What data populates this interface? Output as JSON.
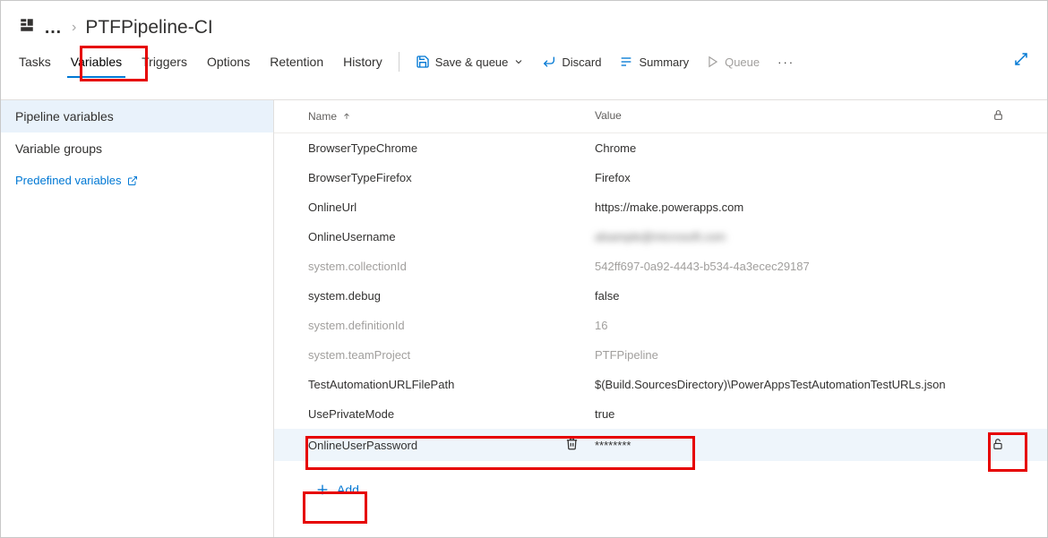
{
  "breadcrumb": {
    "ellipsis": "…",
    "title": "PTFPipeline-CI"
  },
  "tabs": {
    "tasks": "Tasks",
    "variables": "Variables",
    "triggers": "Triggers",
    "options": "Options",
    "retention": "Retention",
    "history": "History"
  },
  "toolbar": {
    "save_queue": "Save & queue",
    "discard": "Discard",
    "summary": "Summary",
    "queue": "Queue"
  },
  "sidebar": {
    "pipeline_vars": "Pipeline variables",
    "variable_groups": "Variable groups",
    "predefined": "Predefined variables"
  },
  "columns": {
    "name": "Name",
    "value": "Value"
  },
  "rows": [
    {
      "name": "BrowserTypeChrome",
      "value": "Chrome",
      "system": false,
      "blurred": false,
      "selected": false
    },
    {
      "name": "BrowserTypeFirefox",
      "value": "Firefox",
      "system": false,
      "blurred": false,
      "selected": false
    },
    {
      "name": "OnlineUrl",
      "value": "https://make.powerapps.com",
      "system": false,
      "blurred": false,
      "selected": false
    },
    {
      "name": "OnlineUsername",
      "value": "alsample@microsoft.com",
      "system": false,
      "blurred": true,
      "selected": false
    },
    {
      "name": "system.collectionId",
      "value": "542ff697-0a92-4443-b534-4a3ecec29187",
      "system": true,
      "blurred": false,
      "selected": false
    },
    {
      "name": "system.debug",
      "value": "false",
      "system": false,
      "blurred": false,
      "selected": false
    },
    {
      "name": "system.definitionId",
      "value": "16",
      "system": true,
      "blurred": false,
      "selected": false
    },
    {
      "name": "system.teamProject",
      "value": "PTFPipeline",
      "system": true,
      "blurred": false,
      "selected": false
    },
    {
      "name": "TestAutomationURLFilePath",
      "value": "$(Build.SourcesDirectory)\\PowerAppsTestAutomationTestURLs.json",
      "system": false,
      "blurred": false,
      "selected": false
    },
    {
      "name": "UsePrivateMode",
      "value": "true",
      "system": false,
      "blurred": false,
      "selected": false
    },
    {
      "name": "OnlineUserPassword",
      "value": "********",
      "system": false,
      "blurred": false,
      "selected": true
    }
  ],
  "add_label": "Add"
}
